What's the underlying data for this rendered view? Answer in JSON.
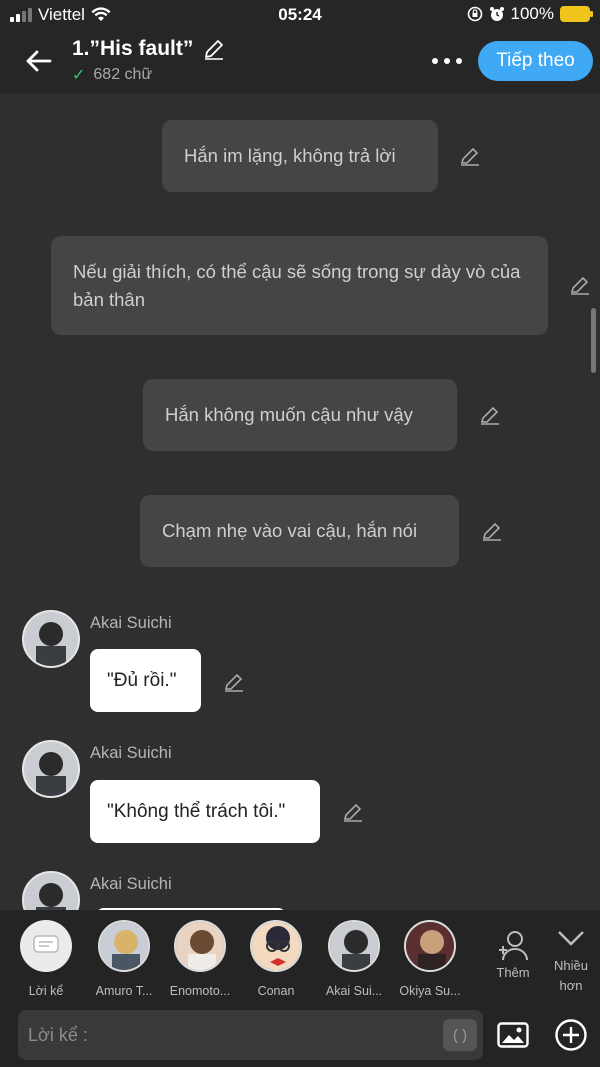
{
  "status_bar": {
    "carrier": "Viettel",
    "time": "05:24",
    "battery": "100%"
  },
  "header": {
    "title": "1.”His fault”",
    "word_count": "682 chữ",
    "next_label": "Tiếp theo"
  },
  "narrations": [
    {
      "text": "Hắn im lặng, không trả lời"
    },
    {
      "text": "Nếu giải thích, có thể cậu sẽ sống trong sự dày vò của bản thân"
    },
    {
      "text": "Hắn không muốn cậu như vậy"
    },
    {
      "text": "Chạm nhẹ vào vai cậu, hắn nói"
    }
  ],
  "messages": [
    {
      "speaker": "Akai Suichi",
      "text": "\"Đủ rồi.\""
    },
    {
      "speaker": "Akai Suichi",
      "text": "\"Không thể trách tôi.\""
    },
    {
      "speaker": "Akai Suichi",
      "text": ""
    }
  ],
  "characters": [
    {
      "name": "Lời kể"
    },
    {
      "name": "Amuro T..."
    },
    {
      "name": "Enomoto..."
    },
    {
      "name": "Conan"
    },
    {
      "name": "Akai Sui..."
    },
    {
      "name": "Okiya Su..."
    }
  ],
  "side_buttons": {
    "add": "Thêm",
    "more": "Nhiều hơn"
  },
  "input": {
    "placeholder": "Lời kể :",
    "paren": "( )"
  },
  "colors": {
    "accent": "#3fa9f5",
    "narration_bg": "#454545",
    "chat_bg": "#2f2f2f"
  }
}
